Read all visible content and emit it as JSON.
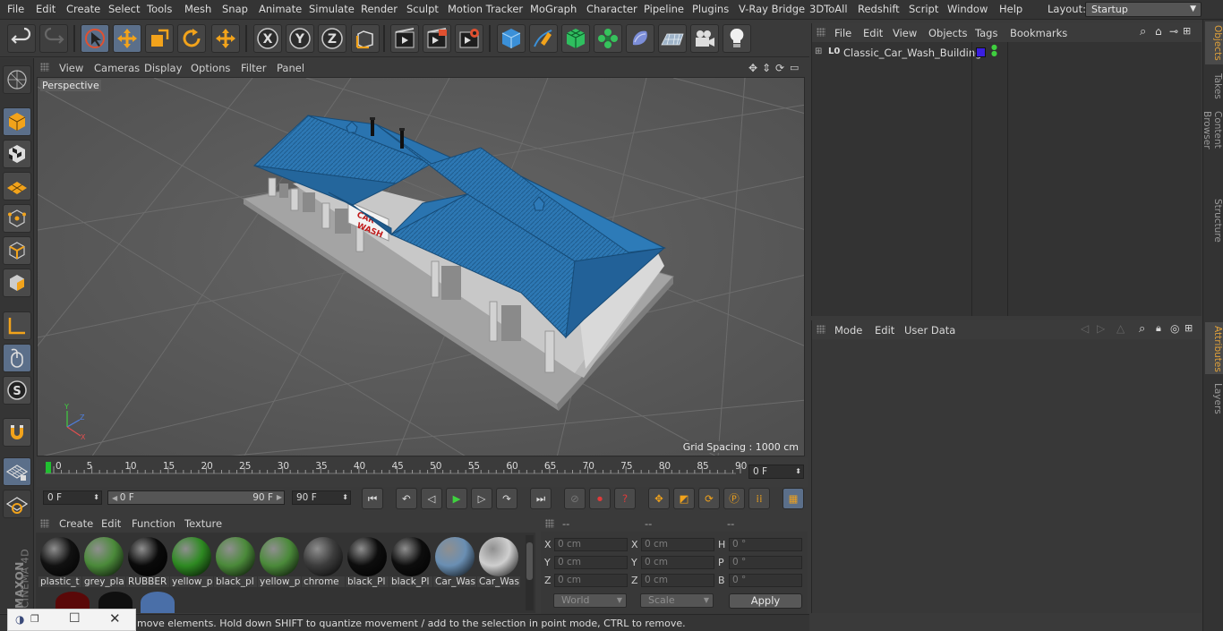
{
  "menubar": {
    "items": [
      "File",
      "Edit",
      "Create",
      "Select",
      "Tools",
      "Mesh",
      "Snap",
      "Animate",
      "Simulate",
      "Render",
      "Sculpt",
      "Motion Tracker",
      "MoGraph",
      "Character",
      "Pipeline",
      "Plugins",
      "V-Ray Bridge",
      "3DToAll",
      "Redshift",
      "Script",
      "Window",
      "Help"
    ],
    "layout_label": "Layout:",
    "layout_value": "Startup"
  },
  "toolbar": {
    "icons": [
      "undo-icon",
      "redo-icon",
      "select-live-icon",
      "move-icon",
      "scale-icon",
      "rotate-icon",
      "move-recent-icon",
      "x-axis-icon",
      "y-axis-icon",
      "z-axis-icon",
      "world-coord-icon",
      "render-view-icon",
      "render-picture-viewer-icon",
      "edit-render-settings-icon",
      "cube-icon",
      "pen-icon",
      "subdivision-icon",
      "cloner-icon",
      "deformer-icon",
      "floor-icon",
      "camera-icon",
      "light-icon"
    ],
    "axis_labels": [
      "X",
      "Y",
      "Z"
    ]
  },
  "viewport": {
    "menu": [
      "View",
      "Cameras",
      "Display",
      "Options",
      "Filter",
      "Panel"
    ],
    "label": "Perspective",
    "grid_spacing": "Grid Spacing : 1000 cm",
    "sign_text": [
      "CAR",
      "WASH"
    ],
    "axes": [
      "Y",
      "Z",
      "X"
    ]
  },
  "timeline": {
    "ticks": [
      "0",
      "5",
      "10",
      "15",
      "20",
      "25",
      "30",
      "35",
      "40",
      "45",
      "50",
      "55",
      "60",
      "65",
      "70",
      "75",
      "80",
      "85",
      "90"
    ],
    "current_frame": "0 F"
  },
  "transport": {
    "start": "0 F",
    "range_start": "0 F",
    "range_end": "90 F",
    "end": "90 F"
  },
  "materials": {
    "menu": [
      "Create",
      "Edit",
      "Function",
      "Texture"
    ],
    "items": [
      {
        "label": "plastic_t",
        "color": "#111111"
      },
      {
        "label": "grey_pla",
        "color": "#4b8a3a"
      },
      {
        "label": "RUBBER",
        "color": "#0a0a0a"
      },
      {
        "label": "yellow_p",
        "color": "#2e8a22"
      },
      {
        "label": "black_pl",
        "color": "#4b8a3a"
      },
      {
        "label": "yellow_p",
        "color": "#4b8a3a"
      },
      {
        "label": "chrome",
        "color": "#3c3c3c"
      },
      {
        "label": "black_Pl",
        "color": "#0d0d0d"
      },
      {
        "label": "black_Pl",
        "color": "#0d0d0d"
      },
      {
        "label": "Car_Was",
        "color": "#6a8fb3"
      },
      {
        "label": "Car_Was",
        "color": "#cfcfcf"
      }
    ]
  },
  "coordinates": {
    "header": [
      "--",
      "--",
      "--"
    ],
    "rows": [
      {
        "pos_label": "X",
        "pos": "0 cm",
        "size_label": "X",
        "size": "0 cm",
        "rot_label": "H",
        "rot": "0 °"
      },
      {
        "pos_label": "Y",
        "pos": "0 cm",
        "size_label": "Y",
        "size": "0 cm",
        "rot_label": "P",
        "rot": "0 °"
      },
      {
        "pos_label": "Z",
        "pos": "0 cm",
        "size_label": "Z",
        "size": "0 cm",
        "rot_label": "B",
        "rot": "0 °"
      }
    ],
    "mode": "World",
    "size_mode": "Scale",
    "apply": "Apply"
  },
  "status": {
    "text": "move elements. Hold down SHIFT to quantize movement / add to the selection in point mode, CTRL to remove."
  },
  "objects": {
    "menu": [
      "File",
      "Edit",
      "View",
      "Objects",
      "Tags",
      "Bookmarks"
    ],
    "tree": [
      {
        "name": "Classic_Car_Wash_Building",
        "layer_color": "#3a1fe0"
      }
    ]
  },
  "attributes": {
    "menu": [
      "Mode",
      "Edit",
      "User Data"
    ]
  },
  "right_tabs": [
    "Objects",
    "Takes",
    "Content Browser",
    "Structure",
    "Attributes",
    "Layers"
  ],
  "brand": [
    "MAXON",
    "CINEMA 4D"
  ]
}
